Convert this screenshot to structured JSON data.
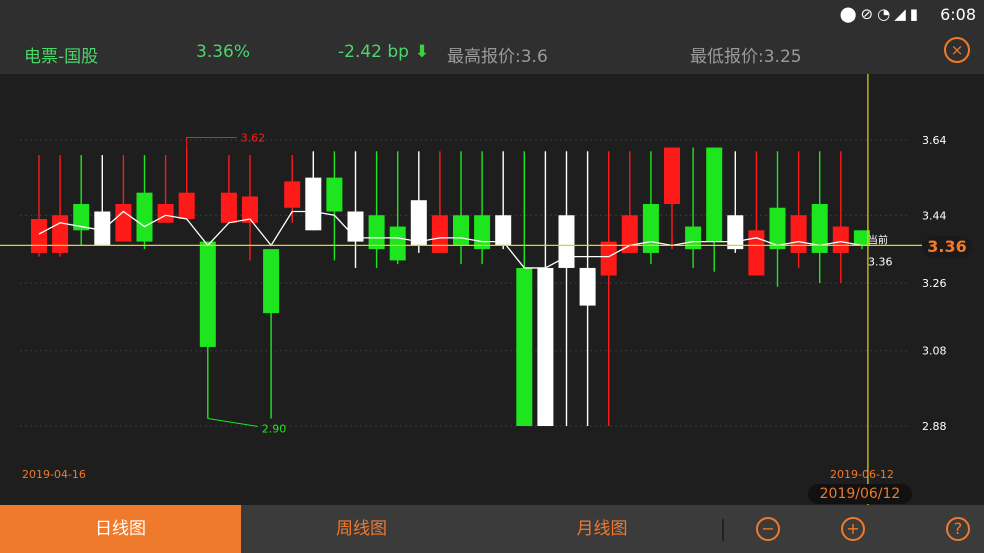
{
  "status": {
    "time": "6:08",
    "icons": [
      "location-icon",
      "no-sound-icon",
      "wifi-icon",
      "signal-icon",
      "battery-icon"
    ]
  },
  "header": {
    "name": "电票-国股",
    "pct": "3.36%",
    "bp": "-2.42 bp",
    "high": "最高报价:3.6",
    "low": "最低报价:3.25"
  },
  "chart_data": {
    "type": "candlestick",
    "yticks": [
      "3.64",
      "3.44",
      "3.26",
      "3.08",
      "2.88"
    ],
    "ytick_values": [
      3.64,
      3.44,
      3.26,
      3.08,
      2.88
    ],
    "ylim": [
      2.84,
      3.71
    ],
    "current_label": "当前",
    "current_value": "3.36",
    "current_badge": "3.36",
    "x_start_label": "2019-04-16",
    "x_end_label": "2019-06-12",
    "max_annotation": "3.62",
    "min_annotation": "2.90",
    "selected_date": "2019/06/12",
    "colors": {
      "up": "#ff1a1a",
      "down": "#1ee61e",
      "flat": "#ffffff",
      "ma": "#ffffff",
      "crosshair": "#e6d21e"
    },
    "candles": [
      {
        "o": 3.43,
        "c": 3.34,
        "h": 3.6,
        "l": 3.33,
        "color": "up"
      },
      {
        "o": 3.44,
        "c": 3.34,
        "h": 3.6,
        "l": 3.33,
        "color": "up"
      },
      {
        "o": 3.47,
        "c": 3.4,
        "h": 3.6,
        "l": 3.36,
        "color": "down"
      },
      {
        "o": 3.45,
        "c": 3.36,
        "h": 3.6,
        "l": 3.36,
        "color": "flat"
      },
      {
        "o": 3.47,
        "c": 3.37,
        "h": 3.6,
        "l": 3.37,
        "color": "up"
      },
      {
        "o": 3.5,
        "c": 3.37,
        "h": 3.6,
        "l": 3.35,
        "color": "down"
      },
      {
        "o": 3.47,
        "c": 3.42,
        "h": 3.6,
        "l": 3.42,
        "color": "up"
      },
      {
        "o": 3.5,
        "c": 3.43,
        "h": 3.62,
        "l": 3.43,
        "color": "up"
      },
      {
        "o": 3.37,
        "c": 3.09,
        "h": 3.37,
        "l": 2.9,
        "color": "down"
      },
      {
        "o": 3.5,
        "c": 3.42,
        "h": 3.6,
        "l": 3.42,
        "color": "up"
      },
      {
        "o": 3.49,
        "c": 3.42,
        "h": 3.6,
        "l": 3.32,
        "color": "up"
      },
      {
        "o": 3.35,
        "c": 3.18,
        "h": 3.35,
        "l": 2.9,
        "color": "down"
      },
      {
        "o": 3.53,
        "c": 3.46,
        "h": 3.6,
        "l": 3.42,
        "color": "up"
      },
      {
        "o": 3.54,
        "c": 3.4,
        "h": 3.61,
        "l": 3.4,
        "color": "flat"
      },
      {
        "o": 3.54,
        "c": 3.45,
        "h": 3.61,
        "l": 3.32,
        "color": "down"
      },
      {
        "o": 3.45,
        "c": 3.37,
        "h": 3.61,
        "l": 3.3,
        "color": "flat"
      },
      {
        "o": 3.44,
        "c": 3.35,
        "h": 3.61,
        "l": 3.3,
        "color": "down"
      },
      {
        "o": 3.41,
        "c": 3.32,
        "h": 3.61,
        "l": 3.31,
        "color": "down"
      },
      {
        "o": 3.48,
        "c": 3.36,
        "h": 3.61,
        "l": 3.34,
        "color": "flat"
      },
      {
        "o": 3.44,
        "c": 3.34,
        "h": 3.61,
        "l": 3.34,
        "color": "up"
      },
      {
        "o": 3.44,
        "c": 3.36,
        "h": 3.61,
        "l": 3.31,
        "color": "down"
      },
      {
        "o": 3.44,
        "c": 3.35,
        "h": 3.61,
        "l": 3.31,
        "color": "down"
      },
      {
        "o": 3.44,
        "c": 3.36,
        "h": 3.61,
        "l": 3.35,
        "color": "flat"
      },
      {
        "o": 3.3,
        "c": 2.88,
        "h": 3.61,
        "l": 2.88,
        "color": "down"
      },
      {
        "o": 3.3,
        "c": 2.88,
        "h": 3.61,
        "l": 2.88,
        "color": "flat"
      },
      {
        "o": 3.44,
        "c": 3.3,
        "h": 3.61,
        "l": 2.88,
        "color": "flat"
      },
      {
        "o": 3.3,
        "c": 3.2,
        "h": 3.61,
        "l": 2.88,
        "color": "flat"
      },
      {
        "o": 3.37,
        "c": 3.28,
        "h": 3.61,
        "l": 2.88,
        "color": "up"
      },
      {
        "o": 3.44,
        "c": 3.34,
        "h": 3.61,
        "l": 3.34,
        "color": "up"
      },
      {
        "o": 3.47,
        "c": 3.34,
        "h": 3.61,
        "l": 3.31,
        "color": "down"
      },
      {
        "o": 3.62,
        "c": 3.47,
        "h": 3.62,
        "l": 3.35,
        "color": "up"
      },
      {
        "o": 3.41,
        "c": 3.35,
        "h": 3.62,
        "l": 3.3,
        "color": "down"
      },
      {
        "o": 3.62,
        "c": 3.37,
        "h": 3.62,
        "l": 3.29,
        "color": "down"
      },
      {
        "o": 3.44,
        "c": 3.35,
        "h": 3.61,
        "l": 3.34,
        "color": "flat"
      },
      {
        "o": 3.4,
        "c": 3.28,
        "h": 3.61,
        "l": 3.28,
        "color": "up"
      },
      {
        "o": 3.46,
        "c": 3.35,
        "h": 3.61,
        "l": 3.25,
        "color": "down"
      },
      {
        "o": 3.44,
        "c": 3.34,
        "h": 3.61,
        "l": 3.3,
        "color": "up"
      },
      {
        "o": 3.47,
        "c": 3.34,
        "h": 3.61,
        "l": 3.26,
        "color": "down"
      },
      {
        "o": 3.41,
        "c": 3.34,
        "h": 3.61,
        "l": 3.26,
        "color": "up"
      },
      {
        "o": 3.4,
        "c": 3.36,
        "h": 3.4,
        "l": 3.35,
        "color": "down"
      }
    ],
    "ma": [
      3.39,
      3.42,
      3.41,
      3.4,
      3.45,
      3.41,
      3.44,
      3.43,
      3.36,
      3.42,
      3.43,
      3.36,
      3.45,
      3.45,
      3.44,
      3.38,
      3.38,
      3.38,
      3.37,
      3.38,
      3.38,
      3.37,
      3.37,
      3.3,
      3.3,
      3.33,
      3.33,
      3.33,
      3.36,
      3.37,
      3.36,
      3.37,
      3.37,
      3.37,
      3.38,
      3.36,
      3.37,
      3.36,
      3.37,
      3.36
    ]
  },
  "tabs": [
    "日线图",
    "周线图",
    "月线图"
  ],
  "toolbar": {
    "zoom_out": "−",
    "zoom_in": "+",
    "help": "?",
    "close": "×"
  }
}
